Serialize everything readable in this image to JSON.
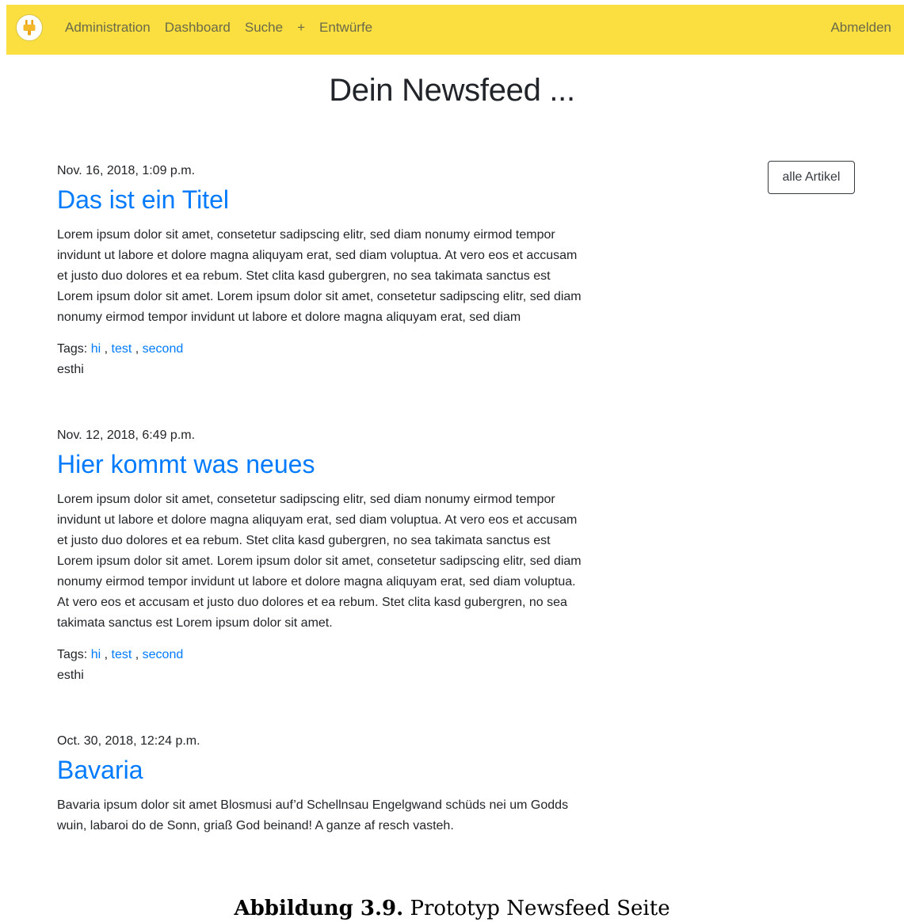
{
  "navbar": {
    "links": [
      "Administration",
      "Dashboard",
      "Suche"
    ],
    "plus": "+",
    "drafts": "Entwürfe",
    "logout": "Abmelden",
    "accent_color": "#fbde3f"
  },
  "page": {
    "title": "Dein Newsfeed ...",
    "all_articles_button": "alle Artikel"
  },
  "articles": [
    {
      "date": "Nov. 16, 2018, 1:09 p.m.",
      "title": "Das ist ein Titel",
      "body": "Lorem ipsum dolor sit amet, consetetur sadipscing elitr, sed diam nonumy eirmod tempor invidunt ut labore et dolore magna aliquyam erat, sed diam voluptua. At vero eos et accusam et justo duo dolores et ea rebum. Stet clita kasd gubergren, no sea takimata sanctus est Lorem ipsum dolor sit amet. Lorem ipsum dolor sit amet, consetetur sadipscing elitr, sed diam nonumy eirmod tempor invidunt ut labore et dolore magna aliquyam erat, sed diam",
      "tags_label": "Tags:",
      "tags": [
        "hi",
        "test",
        "second"
      ],
      "author": "esthi"
    },
    {
      "date": "Nov. 12, 2018, 6:49 p.m.",
      "title": "Hier kommt was neues",
      "body": "Lorem ipsum dolor sit amet, consetetur sadipscing elitr, sed diam nonumy eirmod tempor invidunt ut labore et dolore magna aliquyam erat, sed diam voluptua. At vero eos et accusam et justo duo dolores et ea rebum. Stet clita kasd gubergren, no sea takimata sanctus est Lorem ipsum dolor sit amet. Lorem ipsum dolor sit amet, consetetur sadipscing elitr, sed diam nonumy eirmod tempor invidunt ut labore et dolore magna aliquyam erat, sed diam voluptua. At vero eos et accusam et justo duo dolores et ea rebum. Stet clita kasd gubergren, no sea takimata sanctus est Lorem ipsum dolor sit amet.",
      "tags_label": "Tags:",
      "tags": [
        "hi",
        "test",
        "second"
      ],
      "author": "esthi"
    },
    {
      "date": "Oct. 30, 2018, 12:24 p.m.",
      "title": "Bavaria",
      "body": "Bavaria ipsum dolor sit amet Blosmusi auf’d Schellnsau Engelgwand schüds nei um Godds wuin, labaroi do de Sonn, griaß God beinand! A ganze af resch vasteh."
    }
  ],
  "caption": {
    "label": "Abbildung 3.9.",
    "text": "Prototyp Newsfeed Seite"
  }
}
